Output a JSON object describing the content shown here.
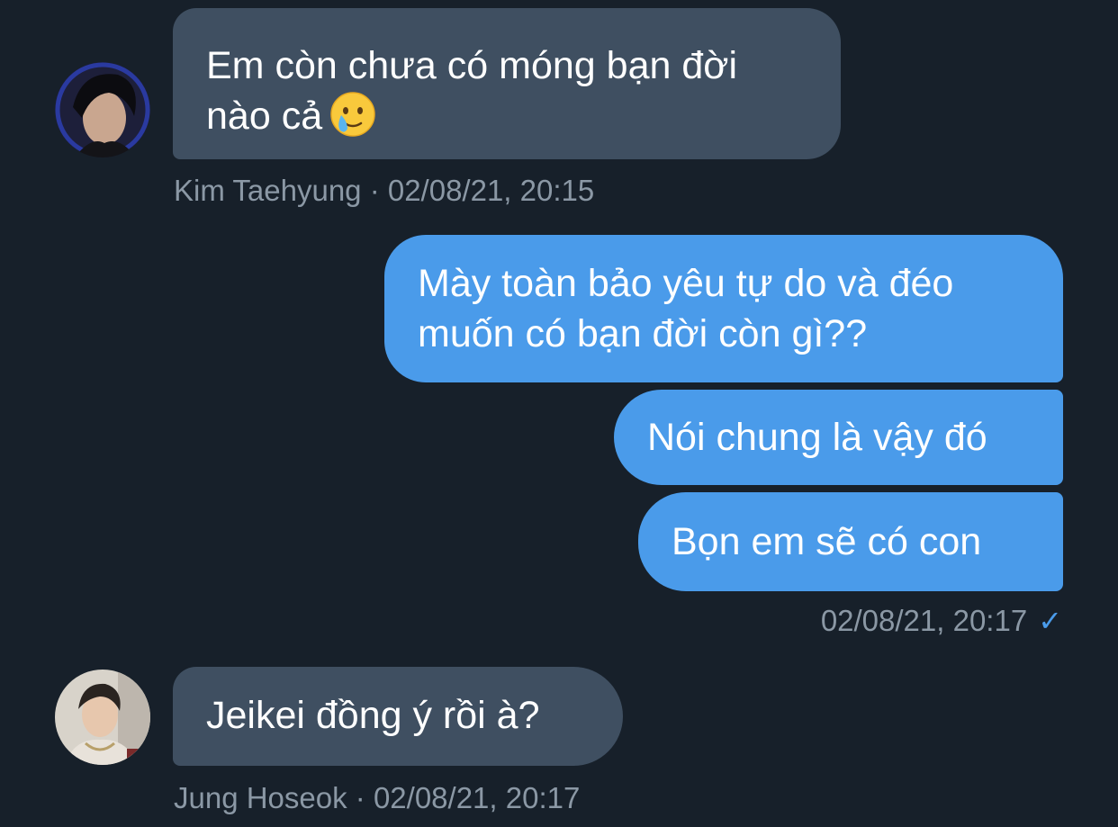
{
  "colors": {
    "background": "#17202a",
    "incoming_bubble": "#3f4f61",
    "outgoing_bubble": "#4a9bea",
    "meta_text": "#8b98a5",
    "check": "#4a9bea"
  },
  "messages": {
    "m1": {
      "line1": "Em còn chưa có móng bạn đời",
      "line2": "nào cả",
      "emoji": "face-holding-back-tears-icon",
      "meta": "Kim Taehyung · 02/08/21, 20:15"
    },
    "m2": {
      "line1": "Mày toàn bảo yêu tự do và đéo",
      "line2": "muốn có bạn đời còn gì??"
    },
    "m3": {
      "text": "Nói chung là vậy đó"
    },
    "m4": {
      "text": "Bọn em sẽ có con",
      "meta": "02/08/21, 20:17",
      "status_icon": "check-icon"
    },
    "m5": {
      "text": "Jeikei đồng ý rồi à?",
      "meta": "Jung Hoseok · 02/08/21, 20:17"
    }
  }
}
